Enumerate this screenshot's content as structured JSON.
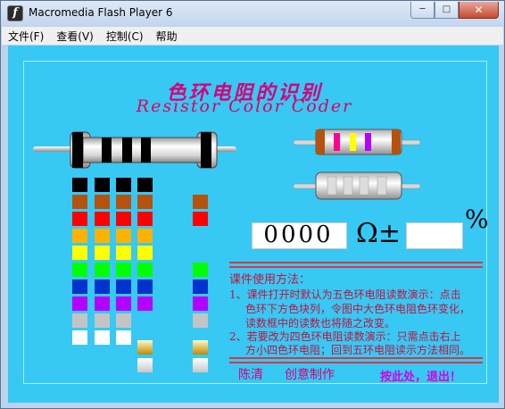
{
  "window": {
    "title": "Macromedia Flash Player 6",
    "icon": "flash-f-icon",
    "caption_buttons": [
      "minimize",
      "maximize",
      "close"
    ]
  },
  "menu": [
    "文件(F)",
    "查看(V)",
    "控制(C)",
    "帮助"
  ],
  "heading": {
    "title_cn": "色环电阻的识别",
    "title_en": "Resistor Color Coder"
  },
  "palette": {
    "black": "#000000",
    "brown": "#b5520e",
    "red": "#ff0000",
    "orange": "#ffb300",
    "yellow": "#ffff00",
    "green": "#00ff00",
    "blue": "#0033cc",
    "violet": "#b400ff",
    "gray": "#c4c4c4",
    "white": "#ffffff",
    "gold": "#e0a800",
    "silver": "#d8d8d8",
    "stage_bg": "#38c8f4",
    "accent_red": "#c0143c",
    "magenta": "#d6007a"
  },
  "color_columns": [
    [
      "black",
      "brown",
      "red",
      "orange",
      "yellow",
      "green",
      "blue",
      "violet",
      "gray",
      "white"
    ],
    [
      "black",
      "brown",
      "red",
      "orange",
      "yellow",
      "green",
      "blue",
      "violet",
      "gray",
      "white"
    ],
    [
      "black",
      "brown",
      "red",
      "orange",
      "yellow",
      "green",
      "blue",
      "violet",
      "gray",
      "white"
    ],
    [
      "black",
      "brown",
      "red",
      "orange",
      "yellow",
      "green",
      "blue",
      "violet",
      "gold",
      "silver"
    ],
    [
      "brown",
      "red",
      "green",
      "blue",
      "violet",
      "gray",
      "gold",
      "silver"
    ]
  ],
  "display": {
    "value": "0000",
    "ohm": "Ω",
    "plus_minus": "±",
    "tolerance": "",
    "percent": "%"
  },
  "howto": {
    "title": "课件使用方法：",
    "lines": [
      "1、课件打开时默认为五色环电阻读数演示：点击",
      "色环下方色块列，令图中大色环电阻色环变化，",
      "读数框中的读数也将随之改变。",
      "2、若要改为四色环电阻读数演示：只需点击右上",
      "方小四色环电阻；回到五环电阻读示方法相同。"
    ]
  },
  "footer": {
    "author": "陈清",
    "credit": "创意制作",
    "exit": "按此处，退出！"
  }
}
